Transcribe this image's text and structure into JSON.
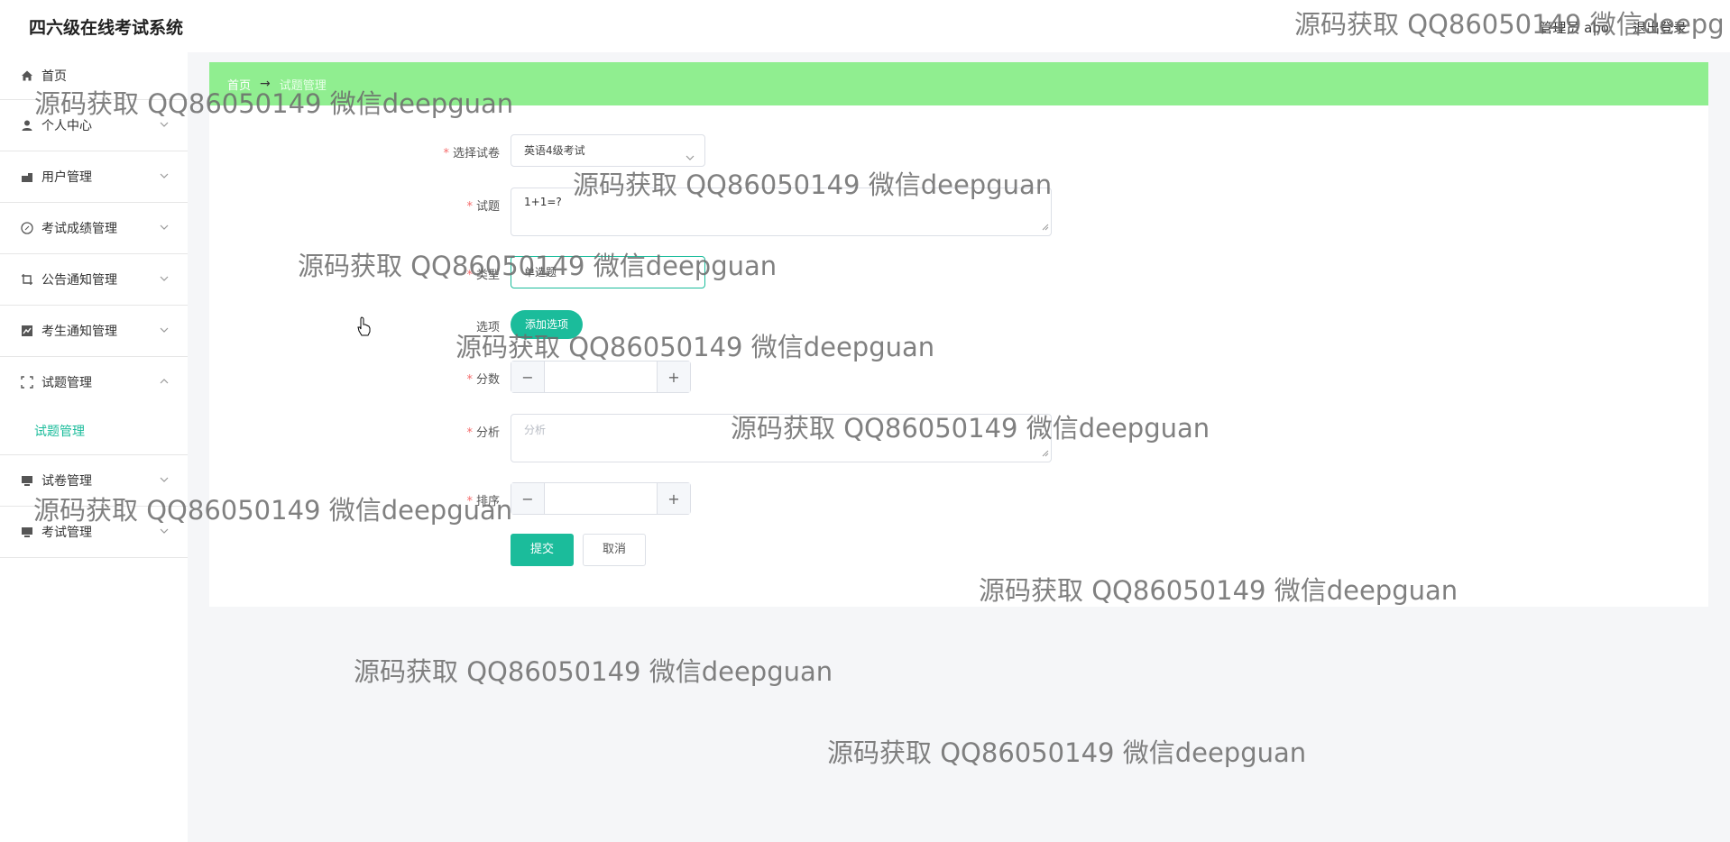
{
  "header": {
    "app_title": "四六级在线考试系统",
    "user_label": "管理员 abo",
    "logout_label": "退出登录"
  },
  "sidebar": {
    "items": [
      {
        "label": "首页",
        "icon": "home-icon"
      },
      {
        "label": "个人中心",
        "icon": "user-icon"
      },
      {
        "label": "用户管理",
        "icon": "users-icon"
      },
      {
        "label": "考试成绩管理",
        "icon": "compass-icon"
      },
      {
        "label": "公告通知管理",
        "icon": "crop-icon"
      },
      {
        "label": "考生通知管理",
        "icon": "chart-icon"
      },
      {
        "label": "试题管理",
        "icon": "scan-icon"
      },
      {
        "label": "试卷管理",
        "icon": "monitor-icon"
      },
      {
        "label": "考试管理",
        "icon": "monitor-icon"
      }
    ],
    "sub_item": "试题管理"
  },
  "breadcrumb": {
    "home": "首页",
    "separator": "→",
    "current": "试题管理"
  },
  "form": {
    "paper_label": "选择试卷",
    "paper_value": "英语4级考试",
    "question_label": "试题",
    "question_value": "1+1=?",
    "type_label": "类型",
    "type_value": "单选题",
    "options_label": "选项",
    "add_option_button": "添加选项",
    "score_label": "分数",
    "score_minus": "−",
    "score_plus": "+",
    "analysis_label": "分析",
    "analysis_placeholder": "分析",
    "sort_label": "排序",
    "submit_button": "提交",
    "cancel_button": "取消"
  },
  "watermark": {
    "text": "源码获取 QQ86050149 微信deepguan",
    "text_cut": "源码获取 QQ86050149 微信deepg"
  },
  "colors": {
    "accent": "#1bbc9b",
    "breadcrumb_bg": "#90ee90",
    "required": "#f56c6c"
  }
}
